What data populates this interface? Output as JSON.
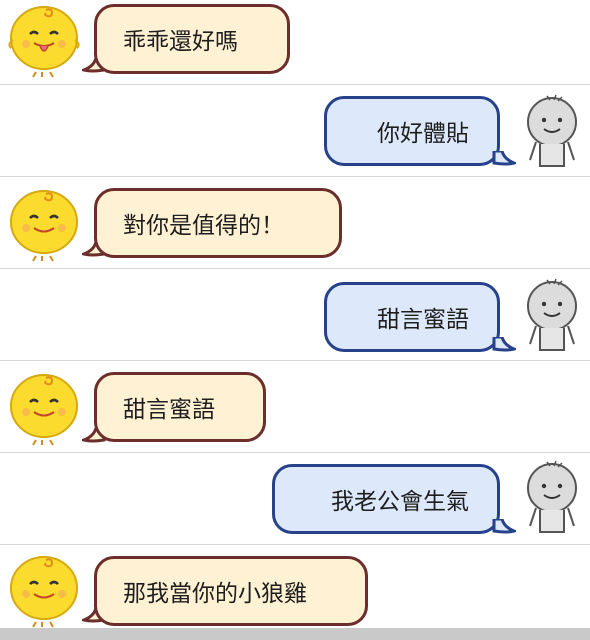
{
  "colors": {
    "bot_bubble_fill": "#fff1d3",
    "bot_bubble_border": "#6b2e2a",
    "user_bubble_fill": "#dde9fb",
    "user_bubble_border": "#27418a",
    "bot_avatar": "#fbdc2e",
    "user_avatar": "#dcdcdc",
    "divider": "#d6d6d6"
  },
  "messages": [
    {
      "sender": "bot",
      "text": "乖乖還好嗎",
      "avatar_icon": "simsimi-tongue-out-icon"
    },
    {
      "sender": "user",
      "text": "你好體貼",
      "avatar_icon": "user-avatar-icon"
    },
    {
      "sender": "bot",
      "text": "對你是值得的！",
      "avatar_icon": "simsimi-smile-icon"
    },
    {
      "sender": "user",
      "text": "甜言蜜語",
      "avatar_icon": "user-avatar-icon"
    },
    {
      "sender": "bot",
      "text": "甜言蜜語",
      "avatar_icon": "simsimi-smile-icon"
    },
    {
      "sender": "user",
      "text": "我老公會生氣",
      "avatar_icon": "user-avatar-icon"
    },
    {
      "sender": "bot",
      "text": "那我當你的小狼雞",
      "avatar_icon": "simsimi-smile-icon"
    }
  ]
}
